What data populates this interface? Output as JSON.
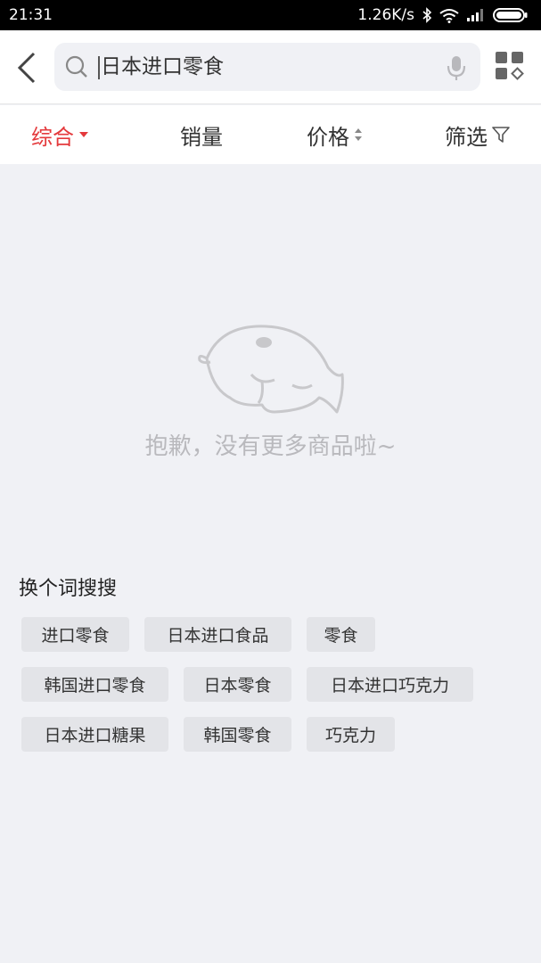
{
  "status_bar": {
    "time": "21:31",
    "speed": "1.26K/s",
    "icons": [
      "bluetooth-icon",
      "wifi-icon",
      "signal-icon",
      "battery-icon"
    ]
  },
  "search": {
    "query": "日本进口零食",
    "icons": [
      "back-arrow-icon",
      "search-icon",
      "microphone-icon",
      "category-grid-icon"
    ]
  },
  "tabs": [
    {
      "label": "综合",
      "icon": "dropdown-triangle-icon"
    },
    {
      "label": "销量"
    },
    {
      "label": "价格",
      "icon": "sort-arrows-icon"
    },
    {
      "label": "筛选",
      "icon": "filter-funnel-icon"
    }
  ],
  "accent_color": "#e4393c",
  "empty_state": {
    "icon": "empty-mascot-icon",
    "message": "抱歉，没有更多商品啦~"
  },
  "suggestions": {
    "title": "换个词搜搜",
    "chips": [
      "进口零食",
      "日本进口食品",
      "零食",
      "韩国进口零食",
      "日本零食",
      "日本进口巧克力",
      "日本进口糖果",
      "韩国零食",
      "巧克力"
    ]
  }
}
